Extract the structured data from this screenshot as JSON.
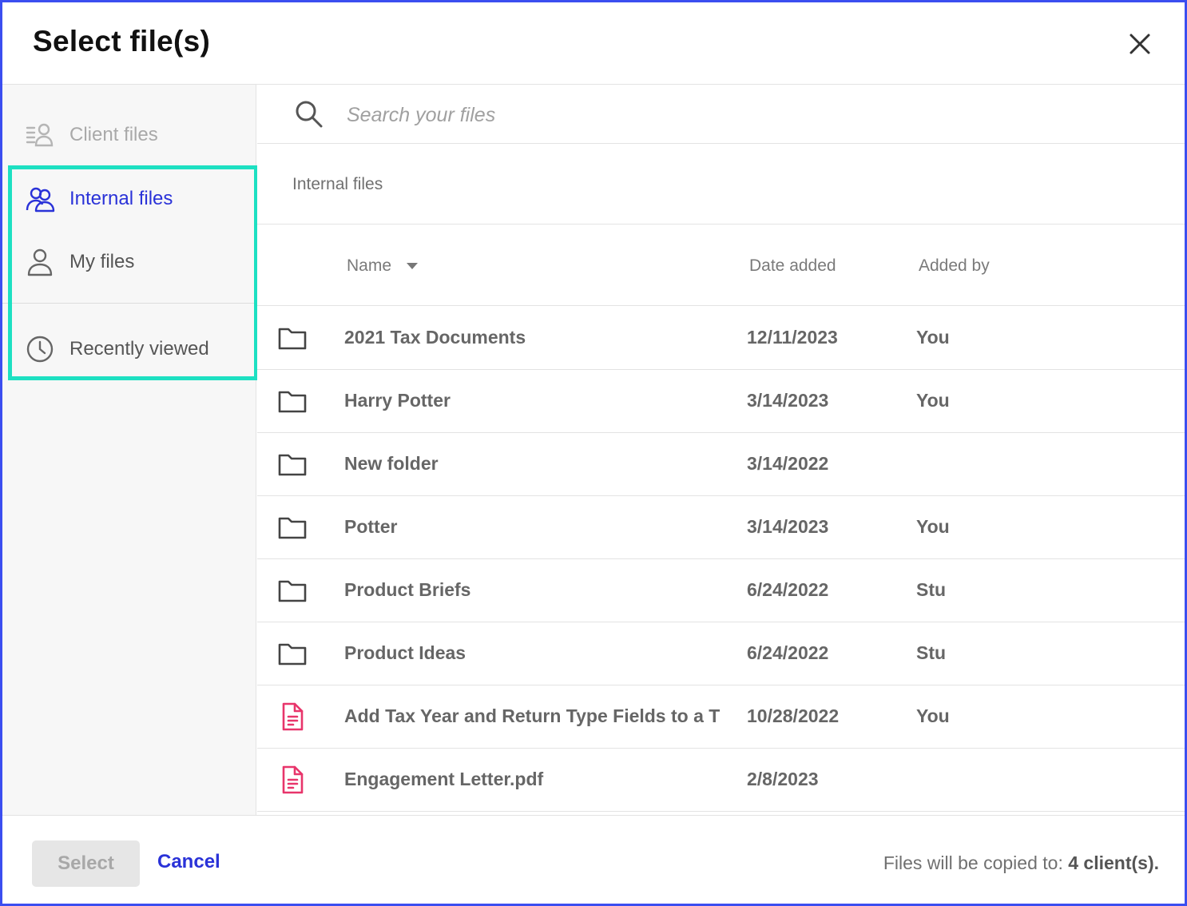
{
  "dialog": {
    "title": "Select file(s)"
  },
  "sidebar": {
    "items": [
      {
        "label": "Client files",
        "icon": "client-files-icon",
        "state": "disabled"
      },
      {
        "label": "Internal files",
        "icon": "users-icon",
        "state": "active"
      },
      {
        "label": "My files",
        "icon": "user-icon",
        "state": "normal"
      },
      {
        "label": "Recently viewed",
        "icon": "clock-icon",
        "state": "normal"
      }
    ]
  },
  "search": {
    "placeholder": "Search your files"
  },
  "breadcrumb": "Internal files",
  "table": {
    "columns": {
      "name": "Name",
      "date": "Date added",
      "by": "Added by"
    },
    "rows": [
      {
        "type": "folder",
        "name": "2021 Tax Documents",
        "date": "12/11/2023",
        "by": "You"
      },
      {
        "type": "folder",
        "name": "Harry Potter",
        "date": "3/14/2023",
        "by": "You"
      },
      {
        "type": "folder",
        "name": "New folder",
        "date": "3/14/2022",
        "by": ""
      },
      {
        "type": "folder",
        "name": "Potter",
        "date": "3/14/2023",
        "by": "You"
      },
      {
        "type": "folder",
        "name": "Product Briefs",
        "date": "6/24/2022",
        "by": "Stu"
      },
      {
        "type": "folder",
        "name": "Product Ideas",
        "date": "6/24/2022",
        "by": "Stu"
      },
      {
        "type": "document",
        "name": "Add Tax Year and Return Type Fields to a T",
        "date": "10/28/2022",
        "by": "You"
      },
      {
        "type": "document",
        "name": "Engagement Letter.pdf",
        "date": "2/8/2023",
        "by": ""
      }
    ]
  },
  "footer": {
    "select_label": "Select",
    "cancel_label": "Cancel",
    "copy_prefix": "Files will be copied to:",
    "copy_target": "4 client(s)."
  },
  "colors": {
    "accent": "#2a32d8",
    "highlight": "#1de0c2",
    "frame": "#3b4ef0",
    "doc_icon": "#e8356b"
  }
}
